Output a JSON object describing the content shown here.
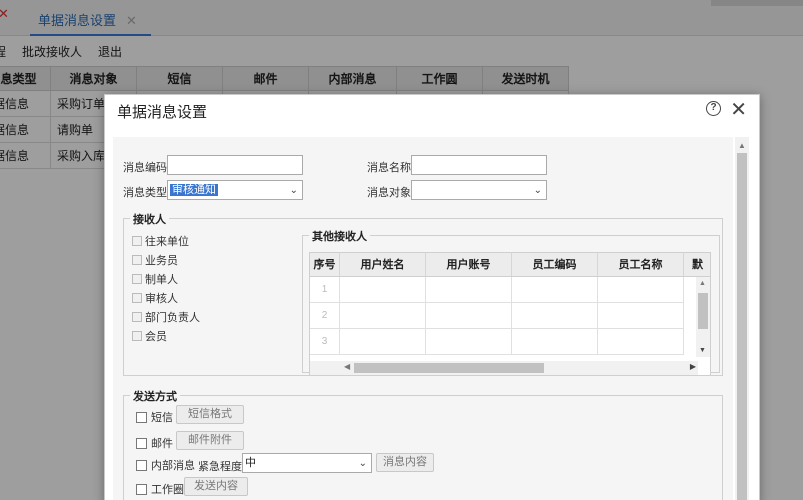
{
  "app": {
    "tab_mark": "✕",
    "tab_label": "单据消息设置",
    "tab_close": "✕",
    "toolbar": [
      "程",
      "批改接收人",
      "退出"
    ],
    "grid": {
      "headers": [
        "息类型",
        "消息对象",
        "短信",
        "邮件",
        "内部消息",
        "工作圆",
        "发送时机"
      ],
      "rows": [
        [
          "据信息",
          "采购订单"
        ],
        [
          "据信息",
          "请购单"
        ],
        [
          "据信息",
          "采购入库"
        ]
      ]
    }
  },
  "dialog": {
    "title": "单据消息设置",
    "help_icon": "?",
    "close_icon": "✕",
    "form": {
      "code_label": "消息编码",
      "code_value": "",
      "name_label": "消息名称",
      "name_value": "",
      "type_label": "消息类型",
      "type_value": "审核通知",
      "object_label": "消息对象",
      "object_value": ""
    },
    "receivers": {
      "legend": "接收人",
      "options": [
        "往来单位",
        "业务员",
        "制单人",
        "审核人",
        "部门负责人",
        "会员"
      ],
      "other": {
        "legend": "其他接收人",
        "headers": [
          "序号",
          "用户姓名",
          "用户账号",
          "员工编码",
          "员工名称",
          "默"
        ],
        "rows": [
          "1",
          "2",
          "3"
        ]
      }
    },
    "send": {
      "legend": "发送方式",
      "sms_label": "短信",
      "sms_button": "短信格式",
      "mail_label": "邮件",
      "mail_button": "邮件附件",
      "internal_label": "内部消息",
      "urgency_label": "紧急程度",
      "urgency_value": "中",
      "internal_button": "消息内容",
      "work_label": "工作圈",
      "work_button": "发送内容"
    }
  },
  "colors": {
    "accent": "#3a76d0",
    "tab_text": "#2a6ab3"
  }
}
